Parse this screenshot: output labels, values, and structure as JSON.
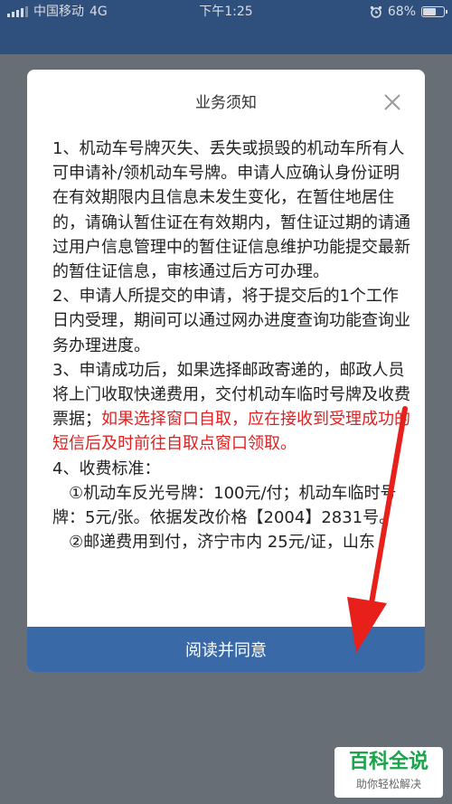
{
  "status_bar": {
    "carrier": "中国移动",
    "network": "4G",
    "time": "下午1:25",
    "battery_text": "68%",
    "battery_level": 0.68,
    "alarm_icon": "alarm-clock-icon"
  },
  "dialog": {
    "title": "业务须知",
    "close_icon": "close-icon",
    "paragraphs": [
      "1、机动车号牌灭失、丢失或损毁的机动车所有人可申请补/领机动车号牌。申请人应确认身份证明在有效期限内且信息未发生变化，在暂住地居住的，请确认暂住证在有效期内，暂住证过期的请通过用户信息管理中的暂住证信息维护功能提交最新的暂住证信息，审核通过后方可办理。",
      "2、申请人所提交的申请，将于提交后的1个工作日内受理，期间可以通过网办进度查询功能查询业务办理进度。"
    ],
    "para3_normal": "3、申请成功后，如果选择邮政寄递的，邮政人员将上门收取快递费用，交付机动车临时号牌及收费票据；",
    "para3_red": "如果选择窗口自取，应在接收到受理成功的短信后及时前往自取点窗口领取。",
    "para4_heading": "4、收费标准：",
    "para4_item1": "①机动车反光号牌：100元/付；机动车临时号牌：5元/张。依据发改价格【2004】2831号。",
    "para4_item2": "②邮递费用到付，济宁市内 25元/证，山东"
  },
  "agree_button": "阅读并同意",
  "watermark": {
    "main": "百科全说",
    "sub": "助你轻松解决"
  },
  "colors": {
    "primary_button": "#3a69a8",
    "highlight_text": "#e02020",
    "arrow": "#e8201c"
  }
}
